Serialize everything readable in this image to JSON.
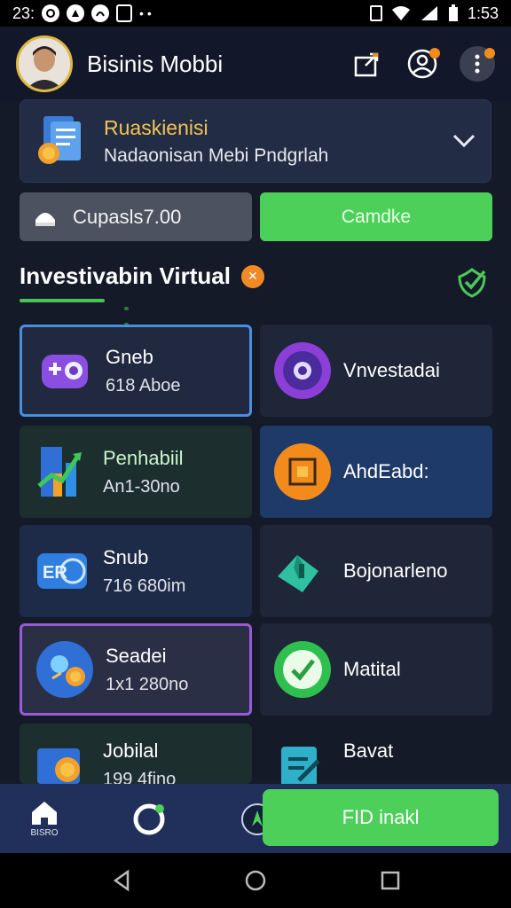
{
  "status_bar": {
    "time_left": "23:",
    "time_right": "1:53"
  },
  "header": {
    "app_title": "Bisinis Mobbi"
  },
  "promo": {
    "title": "Ruaskienisi",
    "subtitle": "Nadaonisan Mebi Pndgrlah"
  },
  "balance": {
    "label": "Cupasls7.00"
  },
  "cta": {
    "label": "Camdke"
  },
  "section": {
    "title": "Investivabin Virtual"
  },
  "cards": [
    {
      "name": "Gneb",
      "sub": "618 Aboe",
      "icon": "gamepad-icon"
    },
    {
      "name": "Vnvestadai",
      "sub": "",
      "icon": "coin-icon"
    },
    {
      "name": "Penhabiil",
      "sub": "An1-30no",
      "icon": "growth-chart-icon"
    },
    {
      "name": "AhdEabd:",
      "sub": "",
      "icon": "frame-icon"
    },
    {
      "name": "Snub",
      "sub": "716 680im",
      "icon": "er-badge-icon"
    },
    {
      "name": "Bojonarleno",
      "sub": "",
      "icon": "folded-map-icon"
    },
    {
      "name": "Seadei",
      "sub": "1x1 280no",
      "icon": "globe-coins-icon"
    },
    {
      "name": "Matital",
      "sub": "",
      "icon": "check-leaf-icon"
    },
    {
      "name": "Jobilal",
      "sub": "199 4fino",
      "icon": "wallet-coins-icon"
    },
    {
      "name": "Bavat",
      "sub": "",
      "icon": "document-edit-icon"
    }
  ],
  "bottom_nav": {
    "home_label": "BISRO",
    "cta_label": "FID inakl"
  },
  "colors": {
    "accent_green": "#4cd05a",
    "accent_orange": "#f08a24",
    "gold": "#f2c451"
  }
}
